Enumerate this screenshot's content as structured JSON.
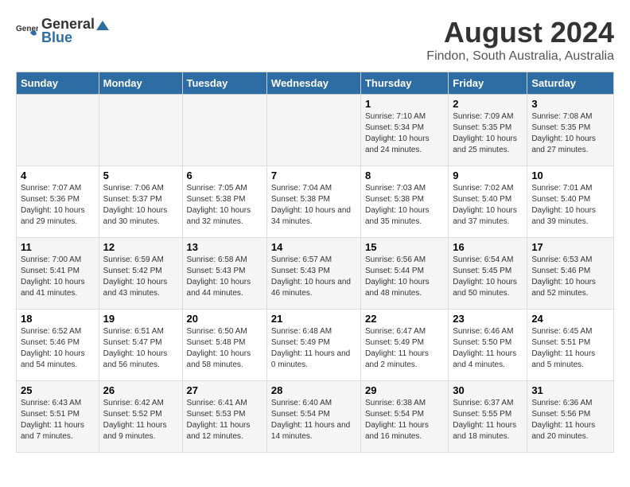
{
  "header": {
    "logo_general": "General",
    "logo_blue": "Blue",
    "title": "August 2024",
    "subtitle": "Findon, South Australia, Australia"
  },
  "weekdays": [
    "Sunday",
    "Monday",
    "Tuesday",
    "Wednesday",
    "Thursday",
    "Friday",
    "Saturday"
  ],
  "weeks": [
    [
      {
        "day": "",
        "sunrise": "",
        "sunset": "",
        "daylight": ""
      },
      {
        "day": "",
        "sunrise": "",
        "sunset": "",
        "daylight": ""
      },
      {
        "day": "",
        "sunrise": "",
        "sunset": "",
        "daylight": ""
      },
      {
        "day": "",
        "sunrise": "",
        "sunset": "",
        "daylight": ""
      },
      {
        "day": "1",
        "sunrise": "Sunrise: 7:10 AM",
        "sunset": "Sunset: 5:34 PM",
        "daylight": "Daylight: 10 hours and 24 minutes."
      },
      {
        "day": "2",
        "sunrise": "Sunrise: 7:09 AM",
        "sunset": "Sunset: 5:35 PM",
        "daylight": "Daylight: 10 hours and 25 minutes."
      },
      {
        "day": "3",
        "sunrise": "Sunrise: 7:08 AM",
        "sunset": "Sunset: 5:35 PM",
        "daylight": "Daylight: 10 hours and 27 minutes."
      }
    ],
    [
      {
        "day": "4",
        "sunrise": "Sunrise: 7:07 AM",
        "sunset": "Sunset: 5:36 PM",
        "daylight": "Daylight: 10 hours and 29 minutes."
      },
      {
        "day": "5",
        "sunrise": "Sunrise: 7:06 AM",
        "sunset": "Sunset: 5:37 PM",
        "daylight": "Daylight: 10 hours and 30 minutes."
      },
      {
        "day": "6",
        "sunrise": "Sunrise: 7:05 AM",
        "sunset": "Sunset: 5:38 PM",
        "daylight": "Daylight: 10 hours and 32 minutes."
      },
      {
        "day": "7",
        "sunrise": "Sunrise: 7:04 AM",
        "sunset": "Sunset: 5:38 PM",
        "daylight": "Daylight: 10 hours and 34 minutes."
      },
      {
        "day": "8",
        "sunrise": "Sunrise: 7:03 AM",
        "sunset": "Sunset: 5:38 PM",
        "daylight": "Daylight: 10 hours and 35 minutes."
      },
      {
        "day": "9",
        "sunrise": "Sunrise: 7:02 AM",
        "sunset": "Sunset: 5:40 PM",
        "daylight": "Daylight: 10 hours and 37 minutes."
      },
      {
        "day": "10",
        "sunrise": "Sunrise: 7:01 AM",
        "sunset": "Sunset: 5:40 PM",
        "daylight": "Daylight: 10 hours and 39 minutes."
      }
    ],
    [
      {
        "day": "11",
        "sunrise": "Sunrise: 7:00 AM",
        "sunset": "Sunset: 5:41 PM",
        "daylight": "Daylight: 10 hours and 41 minutes."
      },
      {
        "day": "12",
        "sunrise": "Sunrise: 6:59 AM",
        "sunset": "Sunset: 5:42 PM",
        "daylight": "Daylight: 10 hours and 43 minutes."
      },
      {
        "day": "13",
        "sunrise": "Sunrise: 6:58 AM",
        "sunset": "Sunset: 5:43 PM",
        "daylight": "Daylight: 10 hours and 44 minutes."
      },
      {
        "day": "14",
        "sunrise": "Sunrise: 6:57 AM",
        "sunset": "Sunset: 5:43 PM",
        "daylight": "Daylight: 10 hours and 46 minutes."
      },
      {
        "day": "15",
        "sunrise": "Sunrise: 6:56 AM",
        "sunset": "Sunset: 5:44 PM",
        "daylight": "Daylight: 10 hours and 48 minutes."
      },
      {
        "day": "16",
        "sunrise": "Sunrise: 6:54 AM",
        "sunset": "Sunset: 5:45 PM",
        "daylight": "Daylight: 10 hours and 50 minutes."
      },
      {
        "day": "17",
        "sunrise": "Sunrise: 6:53 AM",
        "sunset": "Sunset: 5:46 PM",
        "daylight": "Daylight: 10 hours and 52 minutes."
      }
    ],
    [
      {
        "day": "18",
        "sunrise": "Sunrise: 6:52 AM",
        "sunset": "Sunset: 5:46 PM",
        "daylight": "Daylight: 10 hours and 54 minutes."
      },
      {
        "day": "19",
        "sunrise": "Sunrise: 6:51 AM",
        "sunset": "Sunset: 5:47 PM",
        "daylight": "Daylight: 10 hours and 56 minutes."
      },
      {
        "day": "20",
        "sunrise": "Sunrise: 6:50 AM",
        "sunset": "Sunset: 5:48 PM",
        "daylight": "Daylight: 10 hours and 58 minutes."
      },
      {
        "day": "21",
        "sunrise": "Sunrise: 6:48 AM",
        "sunset": "Sunset: 5:49 PM",
        "daylight": "Daylight: 11 hours and 0 minutes."
      },
      {
        "day": "22",
        "sunrise": "Sunrise: 6:47 AM",
        "sunset": "Sunset: 5:49 PM",
        "daylight": "Daylight: 11 hours and 2 minutes."
      },
      {
        "day": "23",
        "sunrise": "Sunrise: 6:46 AM",
        "sunset": "Sunset: 5:50 PM",
        "daylight": "Daylight: 11 hours and 4 minutes."
      },
      {
        "day": "24",
        "sunrise": "Sunrise: 6:45 AM",
        "sunset": "Sunset: 5:51 PM",
        "daylight": "Daylight: 11 hours and 5 minutes."
      }
    ],
    [
      {
        "day": "25",
        "sunrise": "Sunrise: 6:43 AM",
        "sunset": "Sunset: 5:51 PM",
        "daylight": "Daylight: 11 hours and 7 minutes."
      },
      {
        "day": "26",
        "sunrise": "Sunrise: 6:42 AM",
        "sunset": "Sunset: 5:52 PM",
        "daylight": "Daylight: 11 hours and 9 minutes."
      },
      {
        "day": "27",
        "sunrise": "Sunrise: 6:41 AM",
        "sunset": "Sunset: 5:53 PM",
        "daylight": "Daylight: 11 hours and 12 minutes."
      },
      {
        "day": "28",
        "sunrise": "Sunrise: 6:40 AM",
        "sunset": "Sunset: 5:54 PM",
        "daylight": "Daylight: 11 hours and 14 minutes."
      },
      {
        "day": "29",
        "sunrise": "Sunrise: 6:38 AM",
        "sunset": "Sunset: 5:54 PM",
        "daylight": "Daylight: 11 hours and 16 minutes."
      },
      {
        "day": "30",
        "sunrise": "Sunrise: 6:37 AM",
        "sunset": "Sunset: 5:55 PM",
        "daylight": "Daylight: 11 hours and 18 minutes."
      },
      {
        "day": "31",
        "sunrise": "Sunrise: 6:36 AM",
        "sunset": "Sunset: 5:56 PM",
        "daylight": "Daylight: 11 hours and 20 minutes."
      }
    ]
  ]
}
